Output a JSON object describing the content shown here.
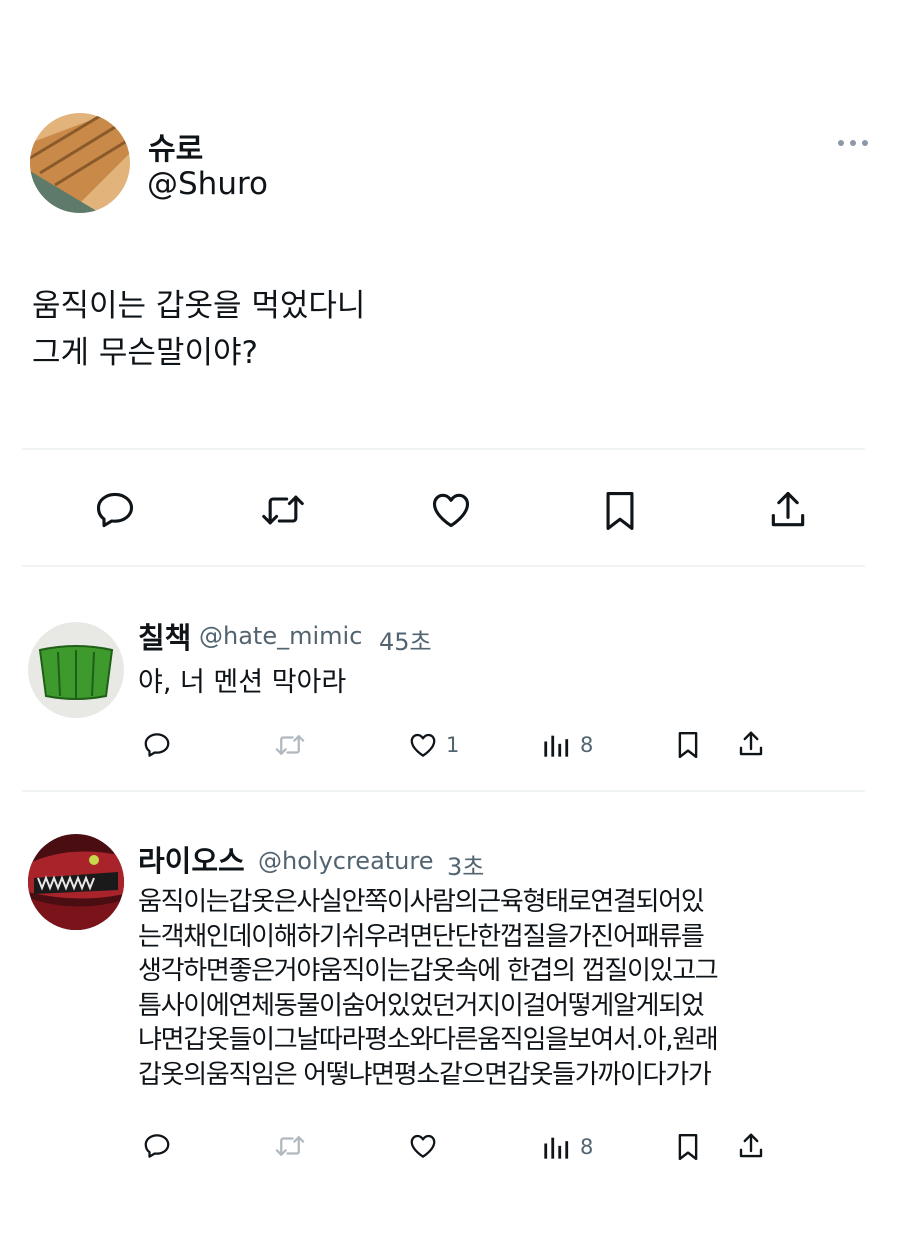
{
  "main_tweet": {
    "author_name": "슈로",
    "author_handle": "@Shuro",
    "text_line1": "움직이는 갑옷을 먹었다니",
    "text_line2": "그게 무슨말이야?"
  },
  "actions": [
    "reply-icon",
    "retweet-icon",
    "like-icon",
    "bookmark-icon",
    "share-icon"
  ],
  "replies": [
    {
      "author_name": "칠책",
      "author_handle": "@hate_mimic",
      "time": "45초",
      "text": "야, 너 멘션 막아라",
      "likes": "1",
      "views": "8"
    },
    {
      "author_name": "라이오스",
      "author_handle": "@holycreature",
      "time": "3초",
      "lines": [
        "움직이는갑옷은사실안쪽이사람의근육형태로연결되어있",
        "는객채인데이해하기쉬우려면단단한껍질을가진어패류를",
        "생각하면좋은거야움직이는갑옷속에 한겹의 껍질이있고그",
        "틈사이에연체동물이숨어있었던거지이걸어떻게알게되었",
        "냐면갑옷들이그날따라평소와다른움직임을보여서.아,원래",
        "갑옷의움직임은 어떻냐면평소같으면갑옷들가까이다가가"
      ],
      "views": "8"
    }
  ],
  "colors": {
    "text": "#0f1419",
    "secondary": "#536471",
    "divider": "#eff3f4"
  }
}
